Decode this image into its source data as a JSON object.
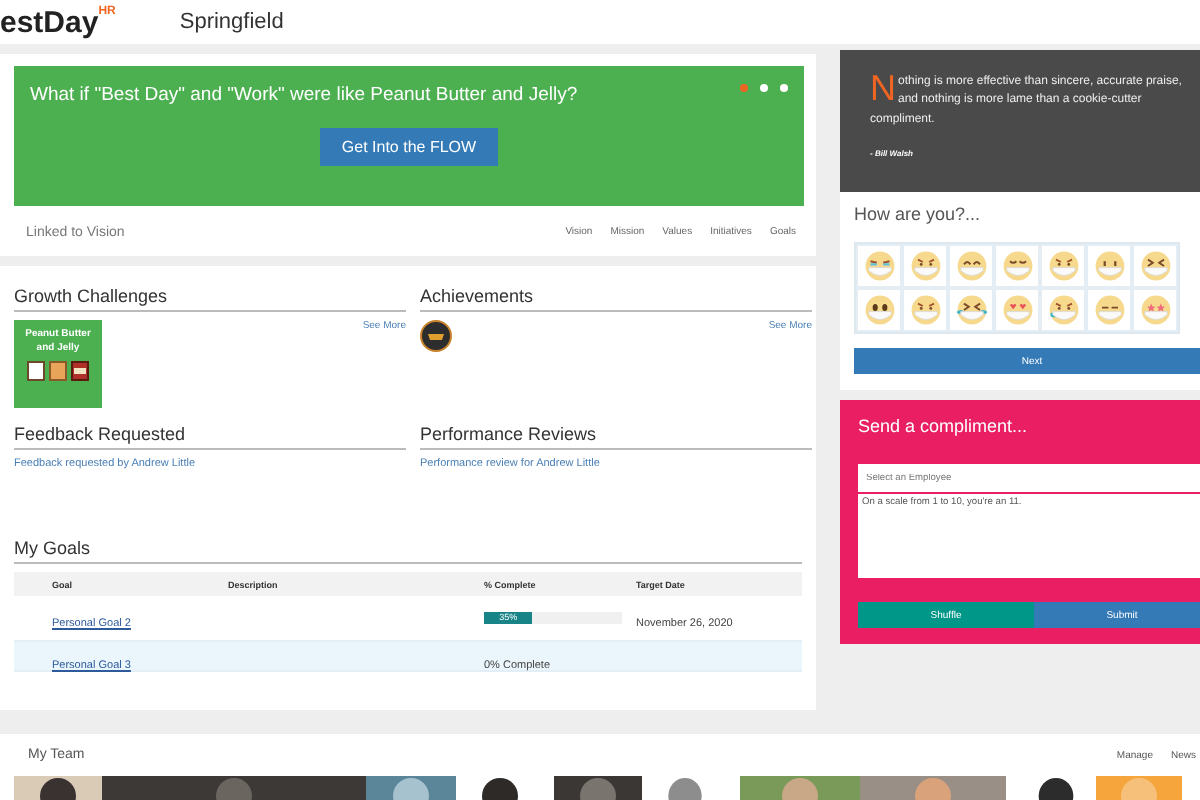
{
  "header": {
    "logo": "estDay",
    "logo_badge": "HR",
    "location": "Springfield"
  },
  "banner": {
    "headline": "What if \"Best Day\" and \"Work\" were like Peanut Butter and Jelly?",
    "button": "Get Into the FLOW",
    "dots": [
      {
        "selected": true
      },
      {
        "selected": false
      },
      {
        "selected": false
      }
    ]
  },
  "vision": {
    "label": "Linked to Vision",
    "links": [
      "Vision",
      "Mission",
      "Values",
      "Initiatives",
      "Goals"
    ]
  },
  "growth_challenges": {
    "title": "Growth Challenges",
    "see_more": "See More",
    "tile": "Peanut Butter and Jelly"
  },
  "achievements": {
    "title": "Achievements",
    "see_more": "See More"
  },
  "feedback": {
    "title": "Feedback Requested",
    "link": "Feedback requested by Andrew Little"
  },
  "reviews": {
    "title": "Performance Reviews",
    "link": "Performance review for Andrew Little"
  },
  "goals": {
    "title": "My Goals",
    "columns": [
      "Goal",
      "Description",
      "% Complete",
      "Target Date"
    ],
    "rows": [
      {
        "goal": "Personal Goal 2",
        "kind": "bar",
        "level": 0.35,
        "percent": "35%",
        "target_date": "November 26, 2020",
        "selected": false
      },
      {
        "goal": "Personal Goal 3",
        "kind": "text",
        "complete": "0% Complete",
        "selected": true
      }
    ]
  },
  "quote": {
    "initial": "N",
    "text": "othing is more effective than sincere, accurate praise, and nothing is more lame than a cookie-cutter compliment.",
    "author": "- Bill Walsh"
  },
  "mood": {
    "title": "How are you?...",
    "button": "Next",
    "faces": [
      {
        "kind": "tears"
      },
      {
        "kind": "angry"
      },
      {
        "kind": "happy"
      },
      {
        "kind": "sad"
      },
      {
        "kind": "angry"
      },
      {
        "kind": "dots"
      },
      {
        "kind": "squint"
      },
      {
        "kind": "wide"
      },
      {
        "kind": "angry"
      },
      {
        "kind": "crying"
      },
      {
        "kind": "love"
      },
      {
        "kind": "tear"
      },
      {
        "kind": "flat"
      },
      {
        "kind": "star"
      }
    ]
  },
  "compliment": {
    "title": "Send a compliment...",
    "employee_placeholder": "Select an Employee",
    "message": "On a scale from 1 to 10, you're an 11.",
    "buttons": [
      {
        "label": "Shuffle",
        "kind": "secondary"
      },
      {
        "label": "Submit",
        "kind": "primary"
      }
    ]
  },
  "team": {
    "title": "My Team",
    "links": [
      "Manage",
      "News"
    ]
  }
}
